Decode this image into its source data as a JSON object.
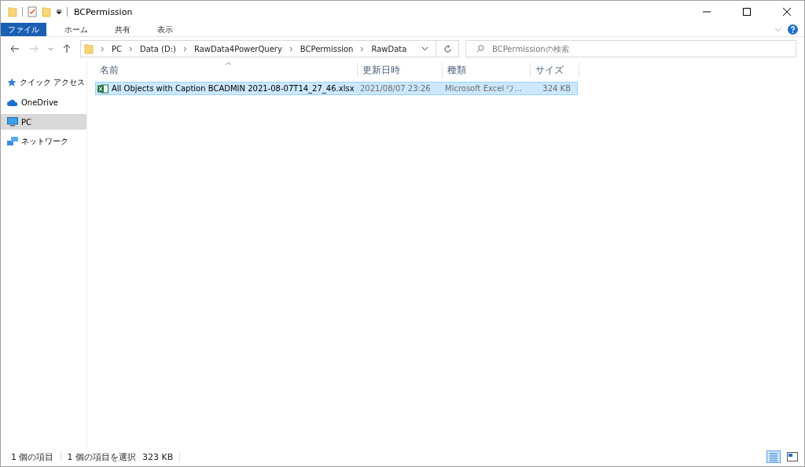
{
  "window": {
    "title": "BCPermission"
  },
  "ribbon_tabs": [
    {
      "label": "ファイル",
      "selected": true
    },
    {
      "label": "ホーム",
      "selected": false
    },
    {
      "label": "共有",
      "selected": false
    },
    {
      "label": "表示",
      "selected": false
    }
  ],
  "address": {
    "crumbs": [
      "PC",
      "Data (D:)",
      "RawData4PowerQuery",
      "BCPermission",
      "RawData"
    ]
  },
  "search": {
    "placeholder": "BCPermissionの検索"
  },
  "sidebar": {
    "items": [
      {
        "label": "クイック アクセス",
        "kind": "star",
        "selected": false
      },
      {
        "label": "OneDrive",
        "kind": "cloud",
        "selected": false
      },
      {
        "label": "PC",
        "kind": "pc",
        "selected": true
      },
      {
        "label": "ネットワーク",
        "kind": "network",
        "selected": false
      }
    ]
  },
  "table": {
    "columns": [
      "名前",
      "更新日時",
      "種類",
      "サイズ"
    ],
    "rows": [
      {
        "name": "All Objects with Caption BCADMIN 2021-08-07T14_27_46.xlsx",
        "modified": "2021/08/07 23:26",
        "type": "Microsoft Excel ワ...",
        "size": "324 KB",
        "selected": true
      }
    ]
  },
  "status_bar": {
    "count": "1 個の項目",
    "selection": "1 個の項目を選択",
    "selection_size": "323 KB"
  }
}
